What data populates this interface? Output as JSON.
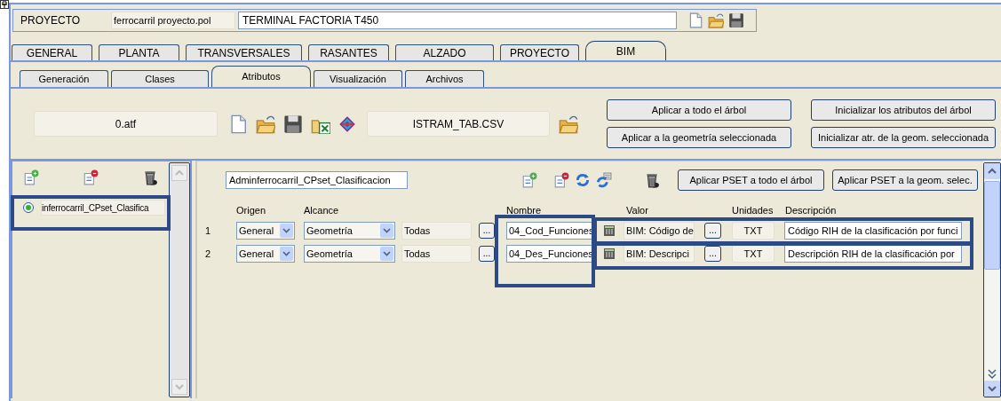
{
  "project": {
    "label": "PROYECTO",
    "file": "ferrocarril proyecto.pol",
    "title": "TERMINAL FACTORIA T450"
  },
  "tabs": [
    {
      "label": "GENERAL",
      "selected": false
    },
    {
      "label": "PLANTA",
      "selected": false
    },
    {
      "label": "TRANSVERSALES",
      "selected": false
    },
    {
      "label": "RASANTES",
      "selected": false
    },
    {
      "label": "ALZADO",
      "selected": false
    },
    {
      "label": "PROYECTO",
      "selected": false
    },
    {
      "label": "BIM",
      "selected": true
    }
  ],
  "subtabs": [
    {
      "label": "Generación",
      "selected": false
    },
    {
      "label": "Clases",
      "selected": false
    },
    {
      "label": "Atributos",
      "selected": true
    },
    {
      "label": "Visualización",
      "selected": false
    },
    {
      "label": "Archivos",
      "selected": false
    }
  ],
  "attribute_file": "0.atf",
  "table_file": "ISTRAM_TAB.CSV",
  "tree_buttons": [
    "Aplicar a todo el árbol",
    "Inicializar los atributos del árbol",
    "Aplicar a la geometría seleccionada",
    "Inicializar atr. de la geom. seleccionada"
  ],
  "psets": [
    {
      "name": "inferrocarril_CPset_Clasifica",
      "selected": true
    }
  ],
  "pset_name": "Adminferrocarril_CPset_Clasificacion",
  "pset_buttons": [
    "Aplicar PSET a todo el árbol",
    "Aplicar PSET a la geom. selec."
  ],
  "columns": [
    "Origen",
    "Alcance",
    "Nombre",
    "Valor",
    "Unidades",
    "Descripción"
  ],
  "rows": [
    {
      "index": "1",
      "origen": "General",
      "alcance": "Geometría",
      "ambito": "Todas",
      "more": "...",
      "nombre": "04_Cod_Funciones",
      "valor": "BIM: Código de",
      "valor_more": "...",
      "unidades": "TXT",
      "descripcion": "Código RIH de la clasificación por funci"
    },
    {
      "index": "2",
      "origen": "General",
      "alcance": "Geometría",
      "ambito": "Todas",
      "more": "...",
      "nombre": "04_Des_Funciones",
      "valor": "BIM: Descripci",
      "valor_more": "...",
      "unidades": "TXT",
      "descripcion": "Descripción RIH de la clasificación por"
    }
  ]
}
